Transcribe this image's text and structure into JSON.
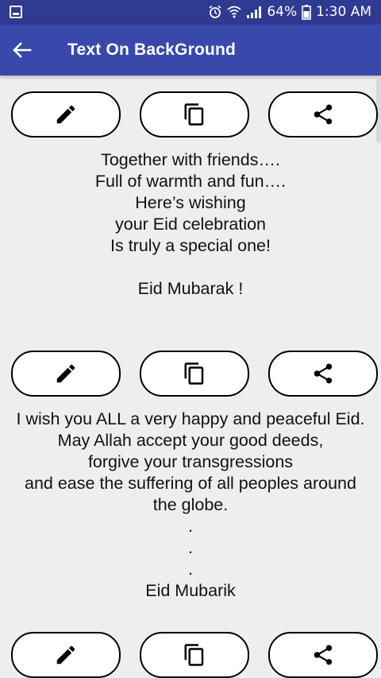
{
  "status_bar": {
    "battery_text": "64%",
    "time": "1:30 AM"
  },
  "app_bar": {
    "title": "Text On BackGround"
  },
  "messages": [
    {
      "lines": [
        "Together with friends….",
        "Full of warmth and fun….",
        "Here’s wishing",
        "your Eid celebration",
        "Is truly a special one!",
        "",
        "Eid Mubarak !"
      ]
    },
    {
      "lines": [
        "I wish you ALL a very happy and peaceful Eid.",
        "May Allah accept your good deeds,",
        "forgive your transgressions",
        "and ease the suffering of all peoples around",
        "the globe.",
        ".",
        ".",
        ".",
        "Eid Mubarik"
      ]
    }
  ],
  "icons": {
    "edit": "pencil-icon",
    "copy": "copy-icon",
    "share": "share-icon"
  }
}
